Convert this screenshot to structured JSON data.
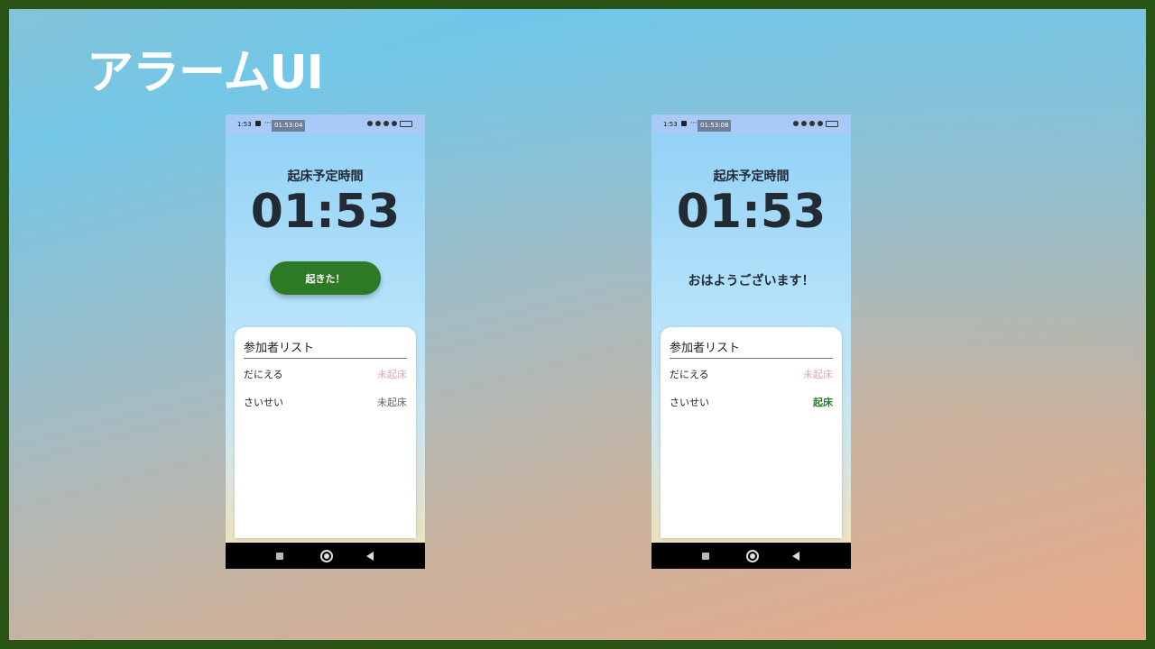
{
  "slide": {
    "title": "アラームUI"
  },
  "screens": [
    {
      "status_time": "1:53",
      "status_dots": "···",
      "status_clock": "01:53:04",
      "wake_label": "起床予定時間",
      "alarm_time": "01:53",
      "button_label": "起きた！",
      "list_title": "参加者リスト",
      "participants": [
        {
          "name": "だにえる",
          "status": "未起床",
          "color": "#e9a8a8"
        },
        {
          "name": "さいせい",
          "status": "未起床",
          "color": "#666666"
        }
      ]
    },
    {
      "status_time": "1:53",
      "status_dots": "···",
      "status_clock": "01:53:08",
      "wake_label": "起床予定時間",
      "alarm_time": "01:53",
      "greeting": "おはようございます！",
      "list_title": "参加者リスト",
      "participants": [
        {
          "name": "だにえる",
          "status": "未起床",
          "color": "#e9a8a8"
        },
        {
          "name": "さいせい",
          "status": "起床",
          "color": "#2e7d32"
        }
      ]
    }
  ],
  "colors": {
    "frame": "#2a5416",
    "button": "#2c7a25",
    "not_awake": "#e9a8a8",
    "awake": "#2e7d32"
  }
}
